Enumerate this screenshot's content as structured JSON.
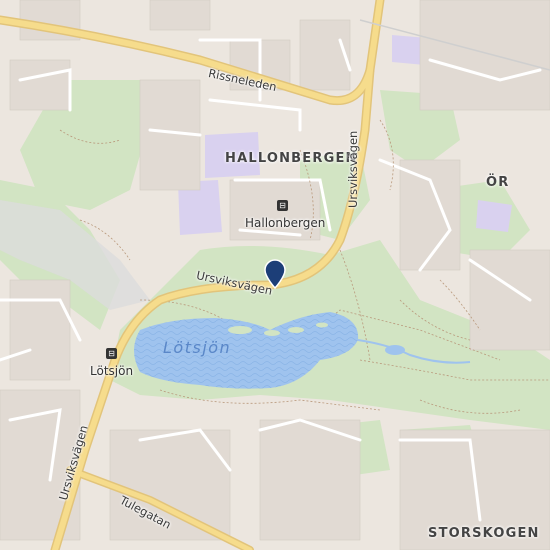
{
  "map": {
    "areas": {
      "hallonbergen": "HALLONBERGEN",
      "storskogen": "STORSKOGEN",
      "or": "ÖR"
    },
    "water": {
      "lake": "Lötsjön"
    },
    "roads": {
      "rissneleden": "Rissneleden",
      "ursviksvagen_north": "Ursviksvägen",
      "ursviksvagen_mid": "Ursviksvägen",
      "ursviksvagen_south": "Ursviksvägen",
      "tulegatan": "Tulegatan"
    },
    "stations": {
      "hallonbergen": "Hallonbergen",
      "lotsjon": "Lötsjön"
    },
    "icons": {
      "station": "metro-station-icon",
      "pin": "location-pin-icon"
    },
    "colors": {
      "water": "#9fc3ee",
      "park": "#cfe3bf",
      "major_road": "#f6dc8c",
      "pin": "#1c3e78"
    }
  }
}
